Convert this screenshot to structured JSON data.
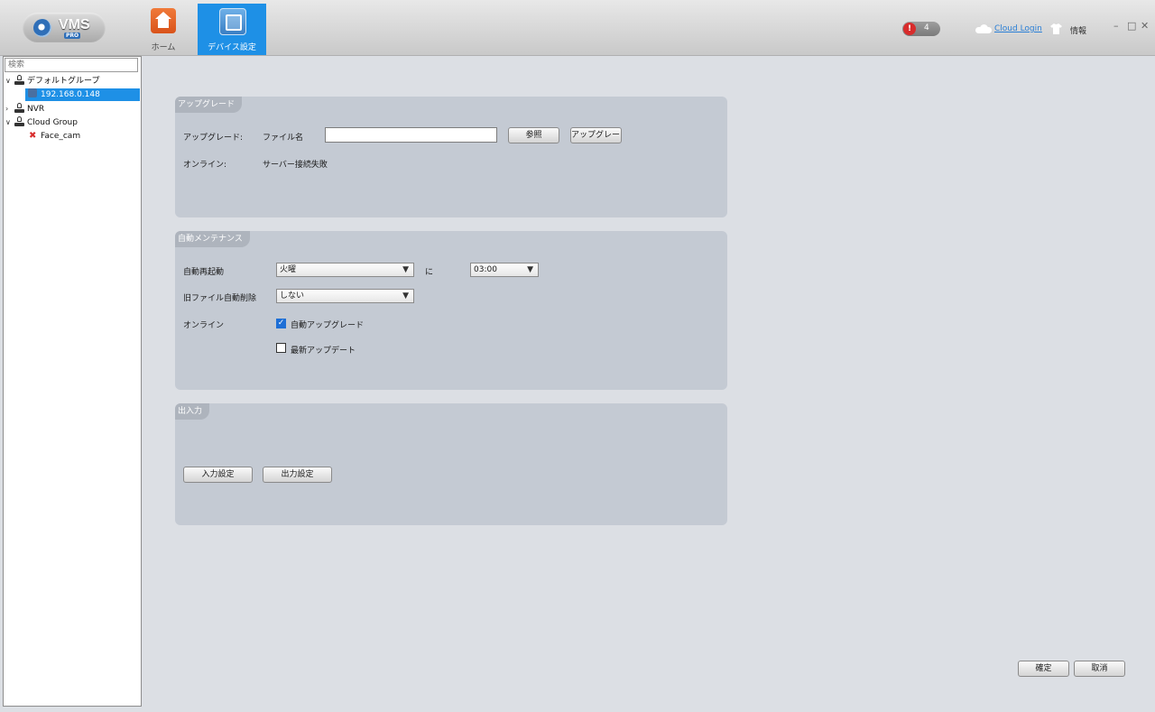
{
  "app": {
    "logo_text": "VMS",
    "logo_sub": "PRO"
  },
  "nav": {
    "tabs": [
      {
        "label": "ホーム",
        "icon": "home-icon"
      },
      {
        "label": "デバイス設定",
        "icon": "device-settings-icon",
        "active": true
      }
    ]
  },
  "header": {
    "alert_icon_glyph": "!",
    "alert_count": "4",
    "cloud_login": "Cloud Login",
    "info_label": "情報",
    "window_controls": {
      "minimize": "–",
      "maximize": "□",
      "close": "✕"
    }
  },
  "sidebar": {
    "search_placeholder": "検索",
    "tree": [
      {
        "label": "デフォルトグループ",
        "type": "group",
        "expanded": true
      },
      {
        "label": "192.168.0.148",
        "type": "device",
        "selected": true
      },
      {
        "label": "NVR",
        "type": "group",
        "expanded": false
      },
      {
        "label": "Cloud Group",
        "type": "group",
        "expanded": true
      },
      {
        "label": "Face_cam",
        "type": "device-offline"
      }
    ]
  },
  "upgrade": {
    "title": "アップグレード",
    "upgrade_label": "アップグレード:",
    "filename_label": "ファイル名",
    "filename_value": "",
    "browse_button": "参照",
    "upgrade_button": "アップグレード",
    "online_label": "オンライン:",
    "online_status": "サーバー接続失敗"
  },
  "maintenance": {
    "title": "自動メンテナンス",
    "auto_reboot_label": "自動再起動",
    "reboot_day": "火曜",
    "at_label": "に",
    "reboot_time": "03:00",
    "auto_delete_label": "旧ファイル自動削除",
    "auto_delete_value": "しない",
    "online_label": "オンライン",
    "auto_upgrade_label": "自動アップグレード",
    "auto_upgrade_checked": true,
    "latest_update_label": "最新アップデート",
    "latest_update_checked": false
  },
  "io": {
    "title": "出入力",
    "input_button": "入力設定",
    "output_button": "出力設定"
  },
  "footer": {
    "ok_button": "確定",
    "cancel_button": "取消"
  },
  "colors": {
    "accent": "#1e90e6",
    "panel": "#c4cad3",
    "background": "#dcdfe4",
    "alert": "#d82c2c"
  }
}
